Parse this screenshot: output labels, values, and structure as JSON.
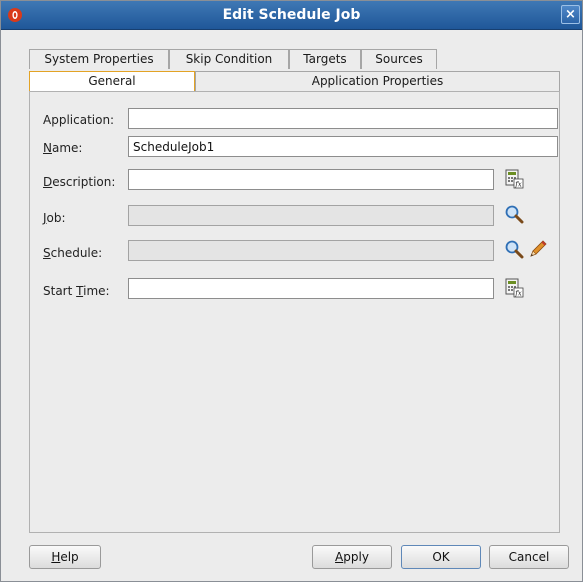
{
  "window": {
    "title": "Edit Schedule Job",
    "close_glyph": "×"
  },
  "tabs_row1": [
    {
      "label": "System Properties"
    },
    {
      "label": "Skip Condition"
    },
    {
      "label": "Targets"
    },
    {
      "label": "Sources"
    }
  ],
  "tabs_row2": [
    {
      "label": "General",
      "selected": true
    },
    {
      "label": "Application Properties",
      "selected": false
    }
  ],
  "form": {
    "application": {
      "label": "Application:",
      "value": ""
    },
    "name": {
      "label_mnemonic": "N",
      "label_rest": "ame:",
      "value": "ScheduleJob1"
    },
    "description": {
      "label_mnemonic": "D",
      "label_rest": "escription:",
      "value": ""
    },
    "job": {
      "label_mnemonic": "J",
      "label_rest": "ob:",
      "value": ""
    },
    "schedule": {
      "label_mnemonic": "S",
      "label_rest": "chedule:",
      "value": ""
    },
    "start_time": {
      "label_pre": "Start ",
      "label_mnemonic": "T",
      "label_rest": "ime:",
      "value": ""
    }
  },
  "buttons": {
    "help": {
      "mnemonic": "H",
      "rest": "elp"
    },
    "apply": {
      "mnemonic": "A",
      "rest": "pply"
    },
    "ok": {
      "label": "OK"
    },
    "cancel": {
      "label": "Cancel"
    }
  },
  "icons": {
    "app": "oracle-app-icon",
    "expression_builder": "expression-builder-icon",
    "search": "magnifier-icon",
    "edit": "pencil-edit-icon"
  },
  "colors": {
    "titlebar": "#2a66aa",
    "selected_tab_border": "#e3a325"
  }
}
